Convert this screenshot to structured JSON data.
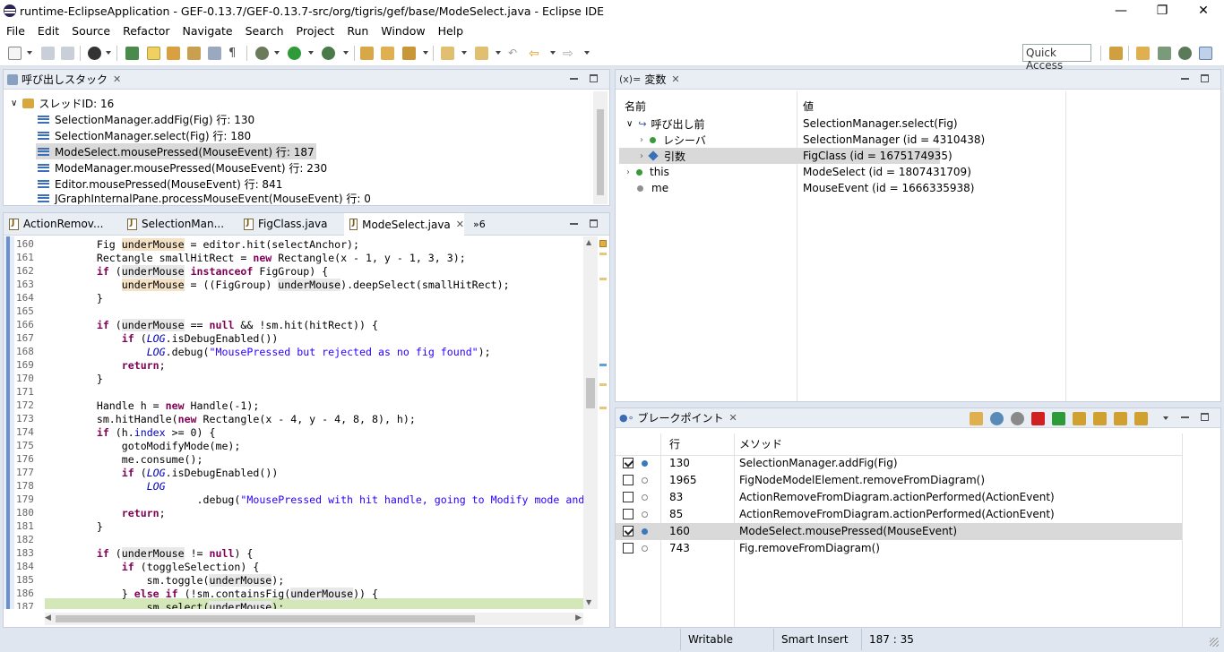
{
  "window": {
    "title": "runtime-EclipseApplication - GEF-0.13.7/GEF-0.13.7-src/org/tigris/gef/base/ModeSelect.java - Eclipse IDE"
  },
  "menu": [
    "File",
    "Edit",
    "Source",
    "Refactor",
    "Navigate",
    "Search",
    "Project",
    "Run",
    "Window",
    "Help"
  ],
  "quick_access": "Quick Access",
  "callstack": {
    "title": "呼び出しスタック",
    "thread": "スレッドID: 16",
    "frames": [
      "SelectionManager.addFig(Fig) 行: 130",
      "SelectionManager.select(Fig) 行: 180",
      "ModeSelect.mousePressed(MouseEvent) 行: 187",
      "ModeManager.mousePressed(MouseEvent) 行: 230",
      "Editor.mousePressed(MouseEvent) 行: 841",
      "JGraphInternalPane.processMouseEvent(MouseEvent) 行: 0"
    ],
    "selected_index": 2
  },
  "editor": {
    "tabs": [
      "ActionRemov...",
      "SelectionMan...",
      "FigClass.java",
      "ModeSelect.java"
    ],
    "active_tab": 3,
    "overflow": "»6",
    "lines": [
      {
        "n": "160",
        "html": "        Fig <span class=\"hl\">underMouse</span> = editor.hit(selectAnchor);"
      },
      {
        "n": "161",
        "html": "        Rectangle smallHitRect = <span class=\"kw\">new</span> Rectangle(x - 1, y - 1, 3, 3);"
      },
      {
        "n": "162",
        "html": "        <span class=\"kw\">if</span> (<span class=\"hl2\">underMouse</span> <span class=\"kw\">instanceof</span> FigGroup) {"
      },
      {
        "n": "163",
        "html": "            <span class=\"hl\">underMouse</span> = ((FigGroup) <span class=\"hl2\">underMouse</span>).deepSelect(smallHitRect);"
      },
      {
        "n": "164",
        "html": "        }"
      },
      {
        "n": "165",
        "html": ""
      },
      {
        "n": "166",
        "html": "        <span class=\"kw\">if</span> (<span class=\"hl2\">underMouse</span> == <span class=\"kw\">null</span> &amp;&amp; !sm.hit(hitRect)) {"
      },
      {
        "n": "167",
        "html": "            <span class=\"kw\">if</span> (<span class=\"it\">LOG</span>.isDebugEnabled())"
      },
      {
        "n": "168",
        "html": "                <span class=\"it\">LOG</span>.debug(<span class=\"str\">\"MousePressed but rejected as no fig found\"</span>);"
      },
      {
        "n": "169",
        "html": "            <span class=\"kw\">return</span>;"
      },
      {
        "n": "170",
        "html": "        }"
      },
      {
        "n": "171",
        "html": ""
      },
      {
        "n": "172",
        "html": "        Handle h = <span class=\"kw\">new</span> Handle(-1);"
      },
      {
        "n": "173",
        "html": "        sm.hitHandle(<span class=\"kw\">new</span> Rectangle(x - 4, y - 4, 8, 8), h);"
      },
      {
        "n": "174",
        "html": "        <span class=\"kw\">if</span> (h.<span class=\"fld\">index</span> &gt;= 0) {"
      },
      {
        "n": "175",
        "html": "            gotoModifyMode(me);"
      },
      {
        "n": "176",
        "html": "            me.consume();"
      },
      {
        "n": "177",
        "html": "            <span class=\"kw\">if</span> (<span class=\"it\">LOG</span>.isDebugEnabled())"
      },
      {
        "n": "178",
        "html": "                <span class=\"it\">LOG</span>"
      },
      {
        "n": "179",
        "html": "                        .debug(<span class=\"str\">\"MousePressed with hit handle, going to Modify mode and</span>"
      },
      {
        "n": "180",
        "html": "            <span class=\"kw\">return</span>;"
      },
      {
        "n": "181",
        "html": "        }"
      },
      {
        "n": "182",
        "html": ""
      },
      {
        "n": "183",
        "html": "        <span class=\"kw\">if</span> (<span class=\"hl2\">underMouse</span> != <span class=\"kw\">null</span>) {"
      },
      {
        "n": "184",
        "html": "            <span class=\"kw\">if</span> (toggleSelection) {"
      },
      {
        "n": "185",
        "html": "                sm.toggle(<span class=\"hl2\">underMouse</span>);"
      },
      {
        "n": "186",
        "html": "            } <span class=\"kw\">else if</span> (!sm.containsFig(<span class=\"hl2\">underMouse</span>)) {"
      },
      {
        "n": "187",
        "html": "                sm.select(<span class=\"hl2\">underMouse</span>);"
      }
    ]
  },
  "variables": {
    "title": "変数",
    "tab_prefix": "(x)=",
    "col_name": "名前",
    "col_value": "値",
    "rows": [
      {
        "name": "呼び出し前",
        "value": "SelectionManager.select(Fig)"
      },
      {
        "name": "レシーバ",
        "value": "SelectionManager (id = 4310438)"
      },
      {
        "name": "引数",
        "value": "FigClass (id = 1675174935)"
      },
      {
        "name": "this",
        "value": "ModeSelect (id = 1807431709)"
      },
      {
        "name": "me",
        "value": "MouseEvent (id = 1666335938)"
      }
    ]
  },
  "breakpoints": {
    "title": "ブレークポイント",
    "col_line": "行",
    "col_method": "メソッド",
    "rows": [
      {
        "checked": true,
        "line": "130",
        "method": "SelectionManager.addFig(Fig)"
      },
      {
        "checked": false,
        "line": "1965",
        "method": "FigNodeModelElement.removeFromDiagram()"
      },
      {
        "checked": false,
        "line": "83",
        "method": "ActionRemoveFromDiagram.actionPerformed(ActionEvent)"
      },
      {
        "checked": false,
        "line": "85",
        "method": "ActionRemoveFromDiagram.actionPerformed(ActionEvent)"
      },
      {
        "checked": true,
        "line": "160",
        "method": "ModeSelect.mousePressed(MouseEvent)"
      },
      {
        "checked": false,
        "line": "743",
        "method": "Fig.removeFromDiagram()"
      }
    ]
  },
  "status": {
    "writable": "Writable",
    "insert": "Smart Insert",
    "position": "187 : 35"
  }
}
